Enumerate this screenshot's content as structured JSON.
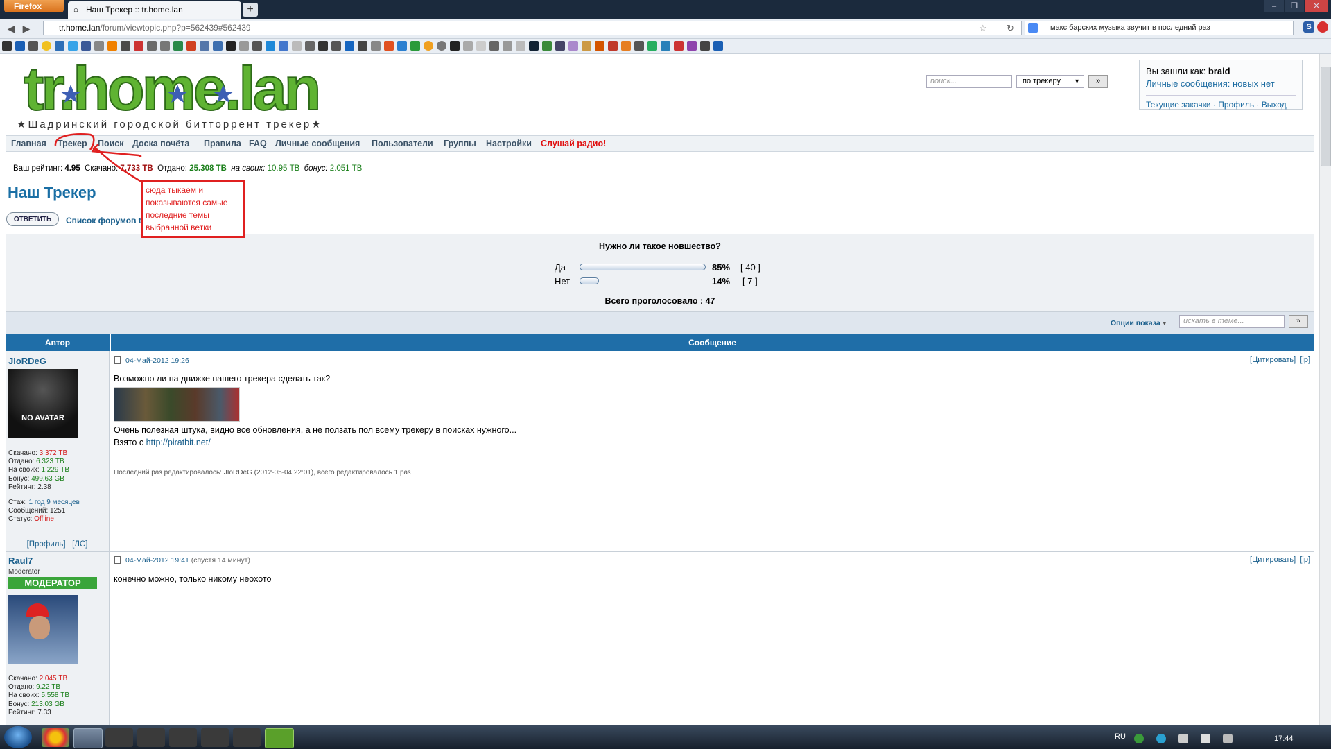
{
  "browser": {
    "menu_button": "Firefox",
    "tab_title": "Наш Трекер :: tr.home.lan",
    "new_tab": "+",
    "url_host": "tr.home.lan",
    "url_path": "/forum/viewtopic.php?p=562439#562439",
    "search_value": "макс барских музыка звучит в последний раз",
    "window_controls": [
      "–",
      "❐",
      "✕"
    ]
  },
  "header": {
    "logo_text": "tr.home.lan",
    "slogan": "★Шадринский городской битторрент трекер★",
    "search_placeholder": "поиск...",
    "search_scope": "по трекеру",
    "search_go": "»"
  },
  "userbox": {
    "logged_label": "Вы зашли как:",
    "username": "braid",
    "pm_status": "Личные сообщения: новых нет",
    "links": "Текущие закачки · Профиль · Выход"
  },
  "menu": [
    "Главная",
    "Трекер",
    "Поиск",
    "Доска почёта",
    "Правила",
    "FAQ",
    "Личные сообщения",
    "Пользователи",
    "Группы",
    "Настройки",
    "Слушай радио!"
  ],
  "stats": {
    "rating_label": "Ваш рейтинг:",
    "rating": "4.95",
    "down_label": "Скачано:",
    "down": "7.733 TB",
    "up_label": "Отдано:",
    "up": "25.308 TB",
    "own_label": "на своих:",
    "own": "10.95 TB",
    "bonus_label": "бонус:",
    "bonus": "2.051 TB"
  },
  "page": {
    "title": "Наш Трекер",
    "reply_button": "ОТВЕТИТЬ",
    "breadcrumb": "Список форумов tr.home.lan » Флуд"
  },
  "poll": {
    "question": "Нужно ли такое новшество?",
    "options": [
      {
        "label": "Да",
        "percent": 85,
        "percent_text": "85%",
        "votes": "[ 40 ]"
      },
      {
        "label": "Нет",
        "percent": 14,
        "percent_text": "14%",
        "votes": "[ 7 ]"
      }
    ],
    "total": "Всего проголосовало : 47"
  },
  "options_bar": {
    "label": "Опции показа",
    "search_placeholder": "искать в теме...",
    "go": "»"
  },
  "table": {
    "col_author": "Автор",
    "col_message": "Сообщение"
  },
  "posts": [
    {
      "author": "JIoRDeG",
      "avatar_text": "NO AVATAR",
      "stats": [
        "Скачано:",
        "3.372 TB",
        "Отдано:",
        "6.323 TB",
        "На своих:",
        "1.229 TB",
        "Бонус:",
        "499.63 GB",
        "Рейтинг:",
        "2.38"
      ],
      "meta": [
        "Стаж:",
        "1 год 9 месяцев",
        "Сообщений:",
        "1251",
        "Статус:",
        "Offline"
      ],
      "profile_links": "[Профиль]   [ЛС]",
      "date": "04-Май-2012 19:26",
      "actions": "[Цитировать]  [ip]",
      "line1": "Возможно ли на движке нашего трекера сделать так?",
      "line2": "Очень полезная штука, видно все обновления, а не ползать пол всему трекеру в поисках нужного...",
      "line3_prefix": "Взято с",
      "line3_link": "http://piratbit.net/",
      "edited": "Последний раз редактировалось: JIoRDeG (2012-05-04 22:01), всего редактировалось 1 раз"
    },
    {
      "author": "Raul7",
      "role": "Moderator",
      "badge": "МОДЕРАТОР",
      "stats": [
        "Скачано:",
        "2.045 TB",
        "Отдано:",
        "9.22 TB",
        "На своих:",
        "5.558 TB",
        "Бонус:",
        "213.03 GB",
        "Рейтинг:",
        "7.33"
      ],
      "date": "04-Май-2012 19:41",
      "date_note": "(спустя 14 минут)",
      "actions": "[Цитировать]  [ip]",
      "line1": "конечно можно, только никому неохото"
    }
  ],
  "annotation": {
    "text": "сюда тыкаем и показываются самые последние темы выбранной ветки",
    "color": "#e02020"
  },
  "taskbar": {
    "lang": "RU",
    "clock": "17:44"
  }
}
